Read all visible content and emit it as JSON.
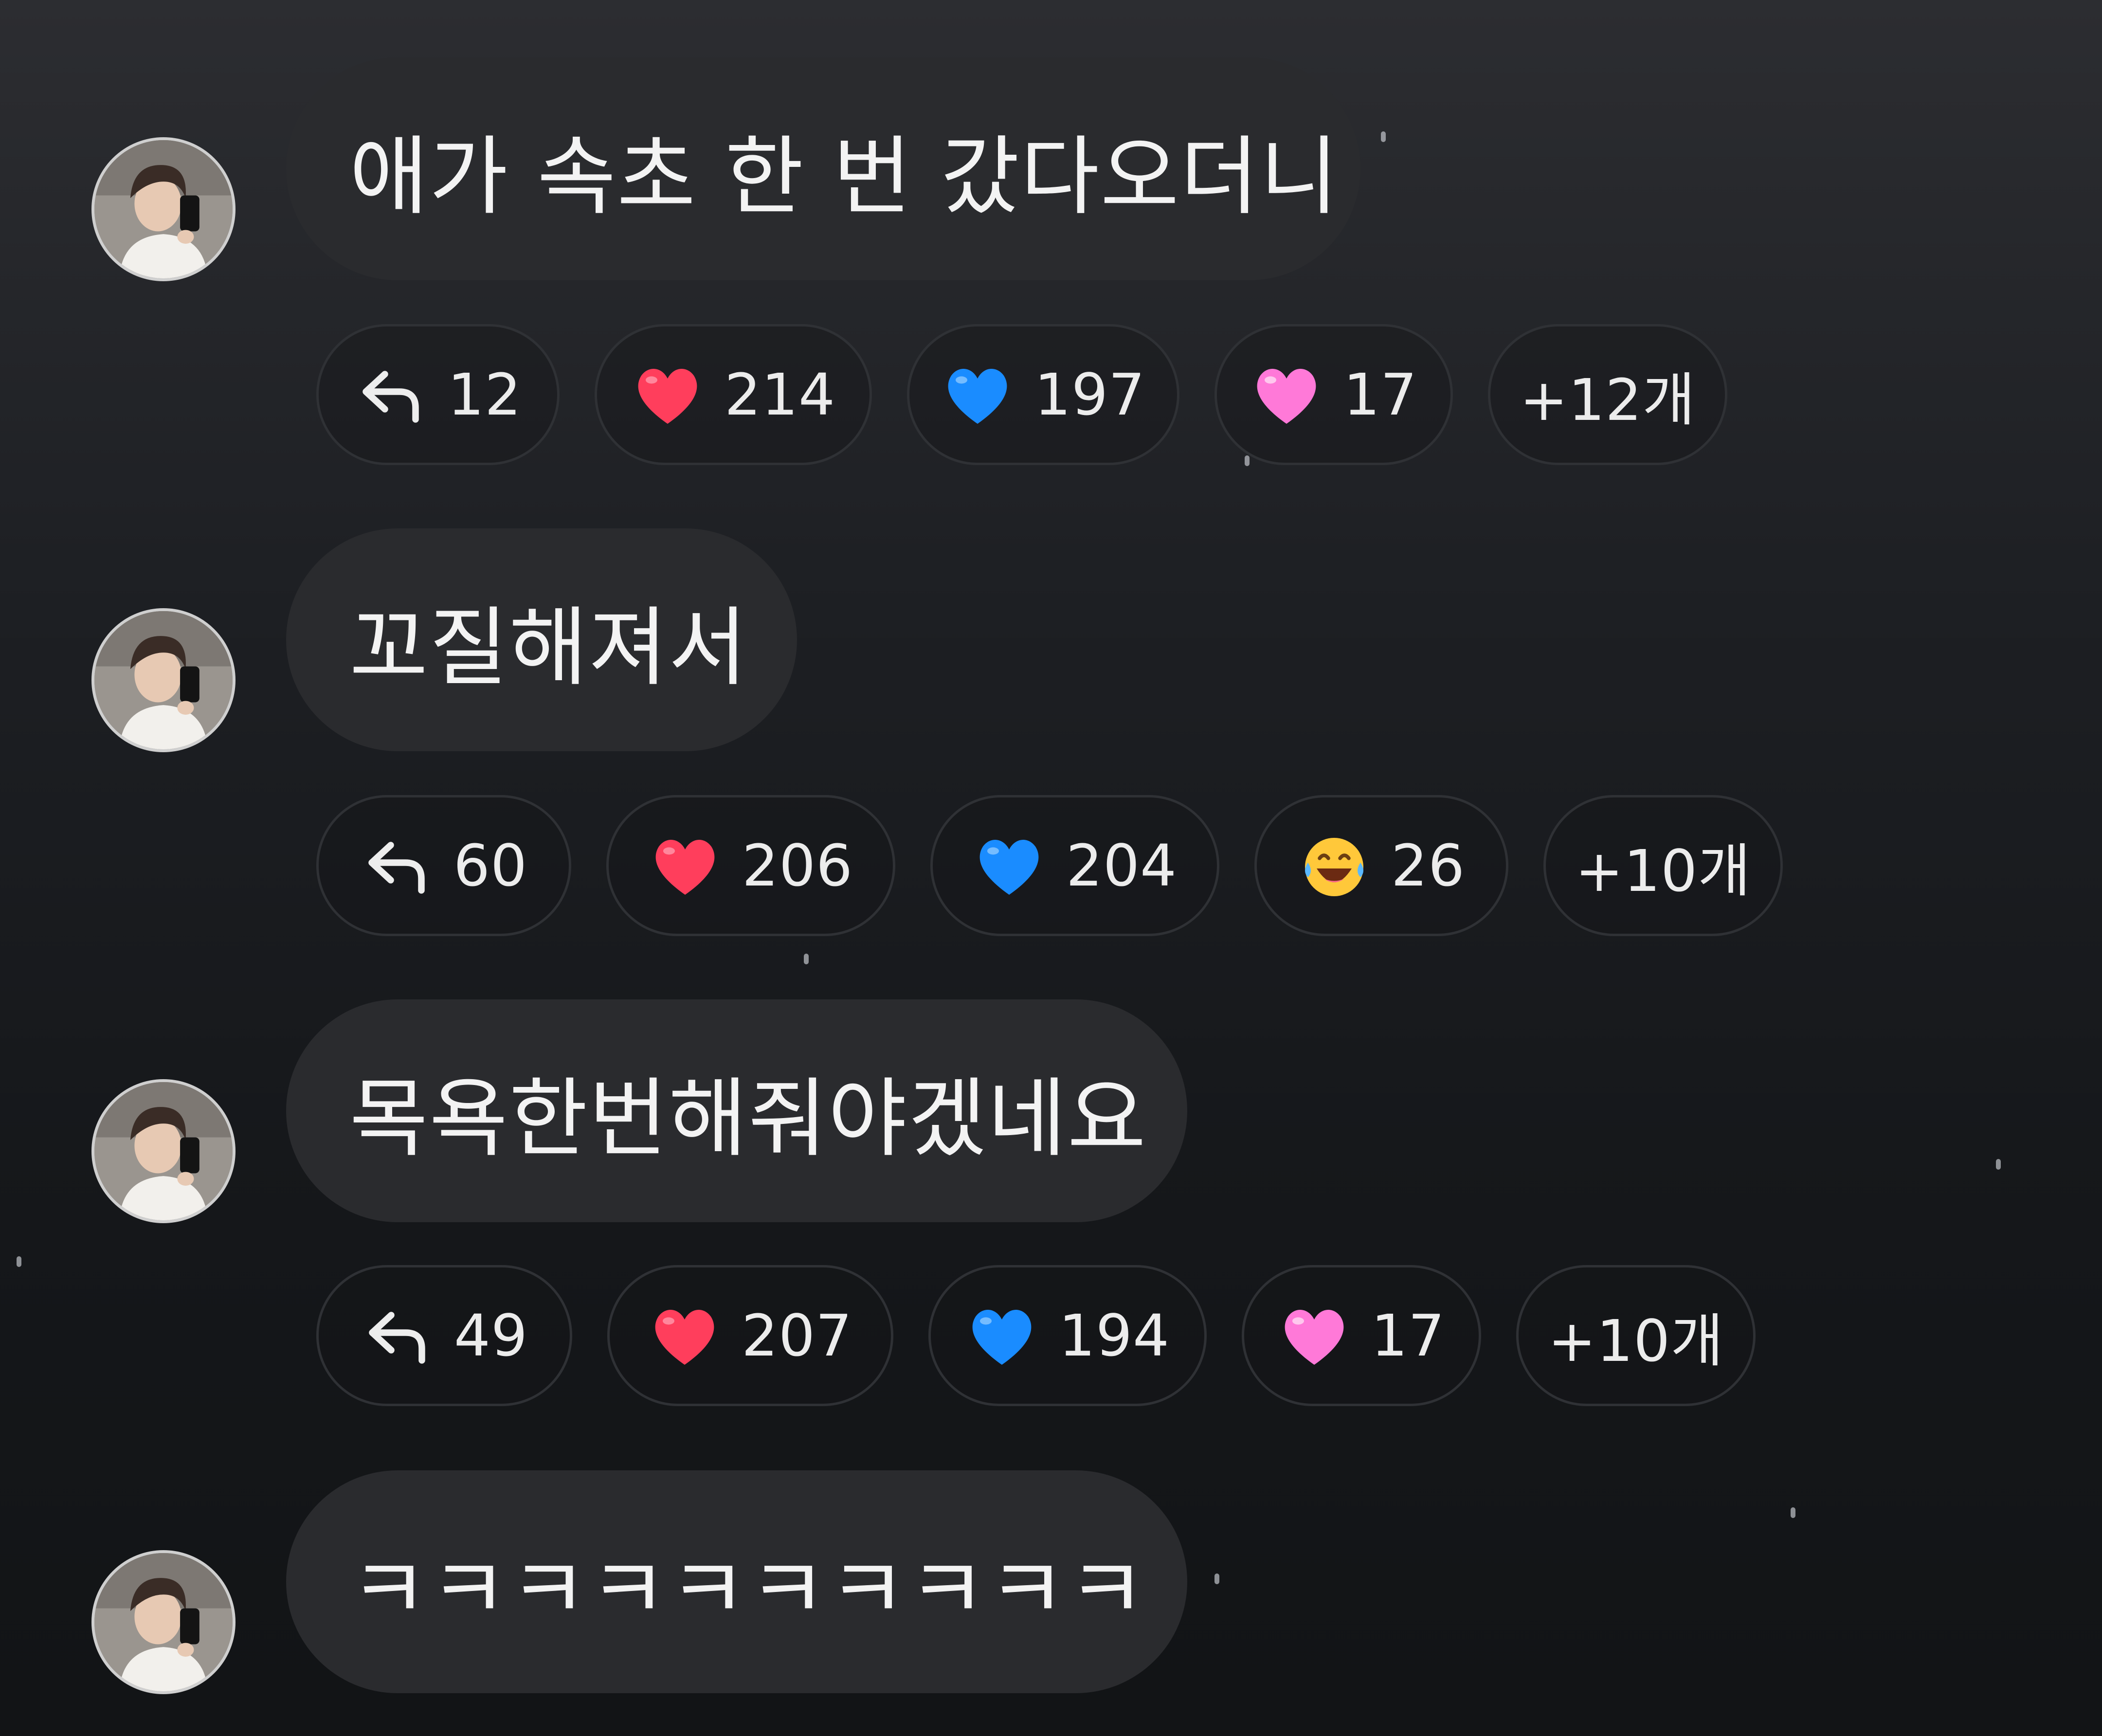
{
  "messages": [
    {
      "text": "애가 속초 한 번 갔다오더니",
      "reactions": [
        {
          "icon": "reply-icon",
          "count": "12"
        },
        {
          "icon": "red-heart-icon",
          "count": "214"
        },
        {
          "icon": "blue-heart-icon",
          "count": "197"
        },
        {
          "icon": "pink-heart-icon",
          "count": "17"
        }
      ],
      "more": "+12개"
    },
    {
      "text": "꼬질해져서",
      "reactions": [
        {
          "icon": "reply-icon",
          "count": "60"
        },
        {
          "icon": "red-heart-icon",
          "count": "206"
        },
        {
          "icon": "blue-heart-icon",
          "count": "204"
        },
        {
          "icon": "laughing-tears-icon",
          "count": "26"
        }
      ],
      "more": "+10개"
    },
    {
      "text": "목욕한번해줘야겠네요",
      "reactions": [
        {
          "icon": "reply-icon",
          "count": "49"
        },
        {
          "icon": "red-heart-icon",
          "count": "207"
        },
        {
          "icon": "blue-heart-icon",
          "count": "194"
        },
        {
          "icon": "pink-heart-icon",
          "count": "17"
        }
      ],
      "more": "+10개"
    },
    {
      "text": "ㅋㅋㅋㅋㅋㅋㅋㅋㅋㅋ"
    }
  ],
  "colors": {
    "bubble": "#2a2b2e",
    "background": "#1d1f23",
    "red_heart": "#ff3e5c",
    "blue_heart": "#1a8cff",
    "pink_heart": "#ff79d8",
    "text": "#f3f3f3"
  }
}
